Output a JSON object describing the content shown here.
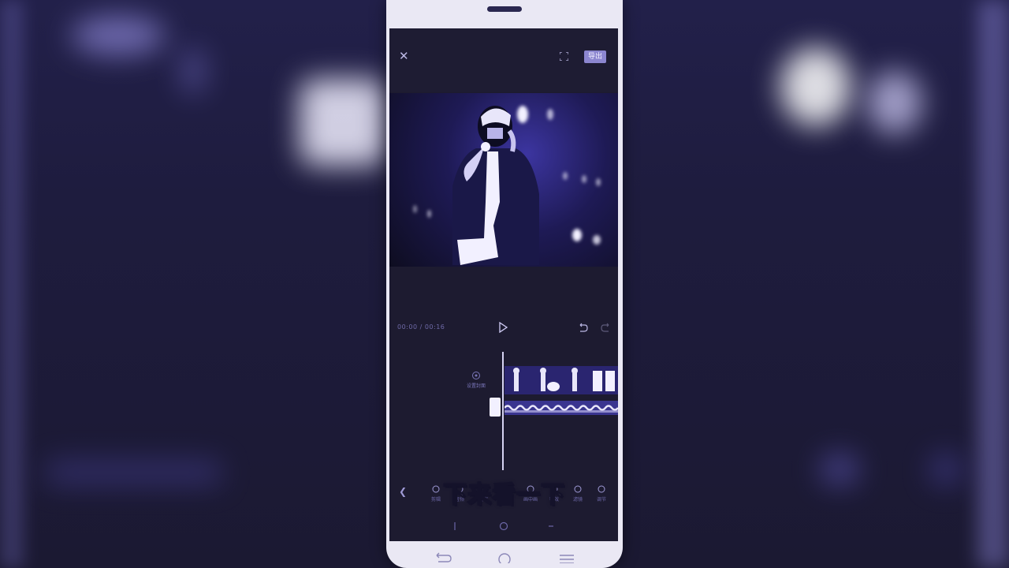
{
  "editor": {
    "export_label": "导出",
    "timecode": "00:00 / 00:16"
  },
  "subtitle": "下来看一下",
  "timeline": {
    "cover_label": "设置封面"
  },
  "toolbar": {
    "tools": [
      {
        "label": "剪辑",
        "icon": "scissors-icon"
      },
      {
        "label": "音频",
        "icon": "music-icon"
      },
      {
        "label": "文字",
        "icon": "text-icon"
      },
      {
        "label": "贴纸",
        "icon": "sticker-icon"
      },
      {
        "label": "画中画",
        "icon": "pip-icon"
      },
      {
        "label": "特效",
        "icon": "effects-icon"
      },
      {
        "label": "滤镜",
        "icon": "filter-icon"
      },
      {
        "label": "调节",
        "icon": "adjust-icon"
      }
    ]
  },
  "colors": {
    "accent": "#8c86d0",
    "screen_bg": "#1d1b30",
    "backdrop": "#1b1934"
  }
}
